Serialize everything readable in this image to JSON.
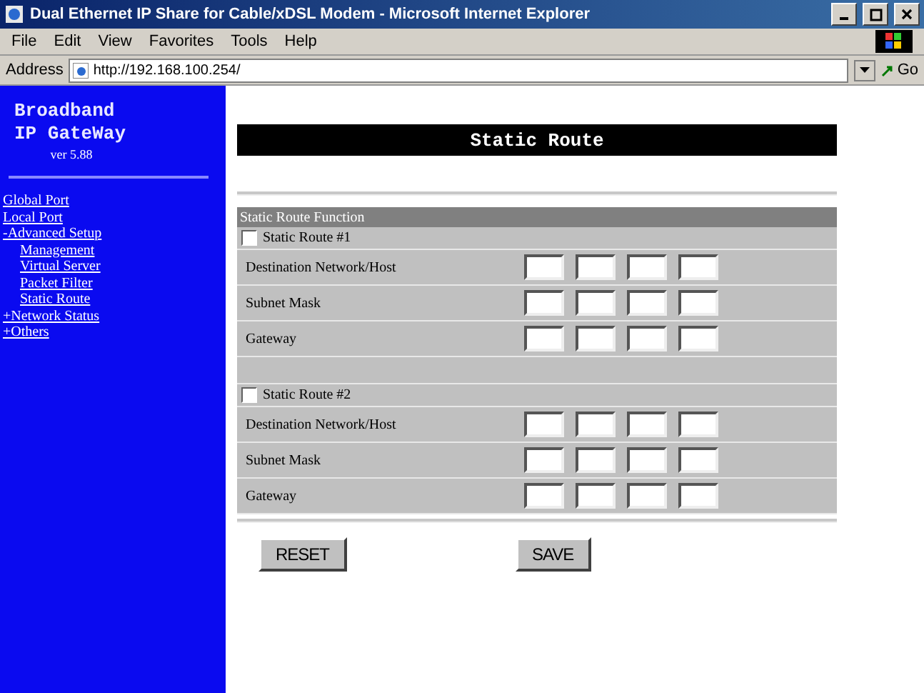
{
  "window": {
    "title": "Dual Ethernet IP Share for Cable/xDSL Modem - Microsoft Internet Explorer"
  },
  "menu": [
    "File",
    "Edit",
    "View",
    "Favorites",
    "Tools",
    "Help"
  ],
  "address_bar": {
    "label": "Address",
    "url": "http://192.168.100.254/",
    "go": "Go"
  },
  "sidebar": {
    "brand": [
      "Broadband",
      "IP GateWay"
    ],
    "version": "ver 5.88",
    "items": [
      {
        "label": "Global Port"
      },
      {
        "label": "Local Port"
      },
      {
        "label": "-Advanced Setup",
        "children": [
          {
            "label": "Management"
          },
          {
            "label": "Virtual Server"
          },
          {
            "label": "Packet Filter"
          },
          {
            "label": "Static Route"
          }
        ]
      },
      {
        "label": "+Network Status"
      },
      {
        "label": "+Others"
      }
    ]
  },
  "page_title": "Static Route",
  "section_title": "Static Route Function",
  "routes": [
    {
      "label": "Static Route #1",
      "checked": false,
      "fields": [
        "Destination Network/Host",
        "Subnet Mask",
        "Gateway"
      ]
    },
    {
      "label": "Static Route #2",
      "checked": false,
      "fields": [
        "Destination Network/Host",
        "Subnet Mask",
        "Gateway"
      ]
    }
  ],
  "buttons": [
    "RESET",
    "SAVE"
  ]
}
